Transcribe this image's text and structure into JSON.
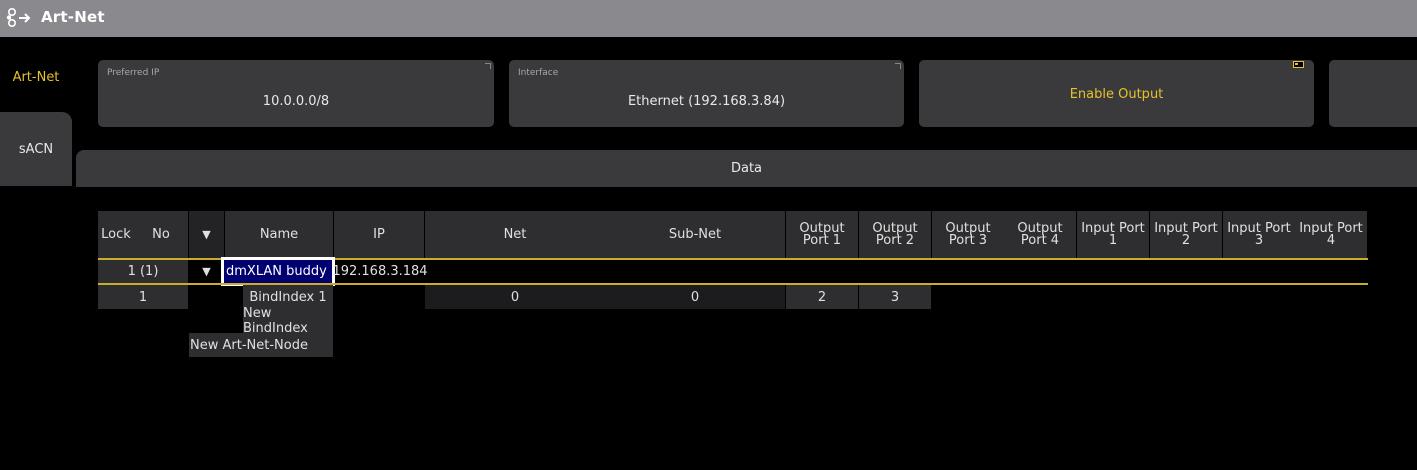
{
  "window": {
    "title": "Art-Net"
  },
  "tabs": {
    "artnet": "Art-Net",
    "sacn": "sACN",
    "data": "Data"
  },
  "settings": {
    "preferred_ip": {
      "label": "Preferred IP",
      "value": "10.0.0.0/8"
    },
    "interface": {
      "label": "Interface",
      "value": "Ethernet (192.168.3.84)"
    },
    "enable_output": {
      "label": "Enable Output"
    }
  },
  "table": {
    "headers": {
      "lock": "Lock",
      "no": "No",
      "expand": "▼",
      "name": "Name",
      "ip": "IP",
      "net": "Net",
      "subnet": "Sub-Net",
      "out1": "Output Port 1",
      "out2": "Output Port 2",
      "out3": "Output Port 3",
      "out4": "Output Port 4",
      "in1": "Input Port 1",
      "in2": "Input Port 2",
      "in3": "Input Port 3",
      "in4": "Input Port 4"
    },
    "node": {
      "no": "1 (1)",
      "expand": "▼",
      "name": "dmXLAN buddy",
      "ip": "192.168.3.184"
    },
    "bind": {
      "no": "1",
      "name": "BindIndex 1",
      "net": "0",
      "subnet": "0",
      "out1": "2",
      "out2": "3"
    },
    "new_bindindex": "New BindIndex",
    "new_node": "New Art-Net-Node"
  },
  "colors": {
    "accent": "#e5c229",
    "selection": "#000070",
    "titlebar": "#8a8a8e"
  }
}
